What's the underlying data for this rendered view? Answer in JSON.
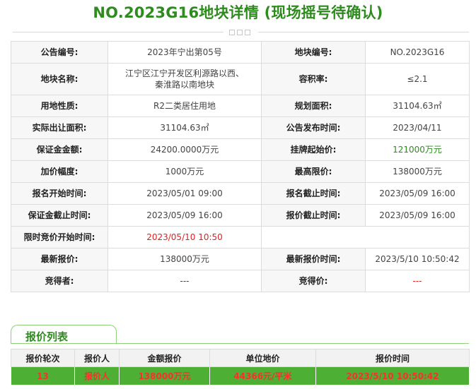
{
  "page": {
    "title": "NO.2023G16地块详情 (现场摇号待确认)"
  },
  "details": {
    "rows": [
      [
        {
          "label": "公告编号:",
          "value": "2023年宁出第05号"
        },
        {
          "label": "地块编号:",
          "value": "NO.2023G16"
        }
      ],
      [
        {
          "label": "地块名称:",
          "value_line1": "江宁区江宁开发区利源路以西、",
          "value_line2": "秦淮路以南地块"
        },
        {
          "label": "容积率:",
          "value": "≤2.1"
        }
      ],
      [
        {
          "label": "用地性质:",
          "value": "R2二类居住用地"
        },
        {
          "label": "规划面积:",
          "value": "31104.63㎡"
        }
      ],
      [
        {
          "label": "实际出让面积:",
          "value": "31104.63㎡"
        },
        {
          "label": "公告发布时间:",
          "value": "2023/04/11"
        }
      ],
      [
        {
          "label": "保证金金额:",
          "value": "24200.0000万元"
        },
        {
          "label": "挂牌起始价:",
          "value": "121000万元"
        }
      ],
      [
        {
          "label": "加价幅度:",
          "value": "1000万元"
        },
        {
          "label": "最高限价:",
          "value": "138000万元"
        }
      ],
      [
        {
          "label": "报名开始时间:",
          "value": "2023/05/01 09:00"
        },
        {
          "label": "报名截止时间:",
          "value": "2023/05/09 16:00"
        }
      ],
      [
        {
          "label": "保证金截止时间:",
          "value": "2023/05/09 16:00"
        },
        {
          "label": "报价截止时间:",
          "value": "2023/05/09 16:00"
        }
      ],
      [
        {
          "label": "限时竞价开始时间:",
          "value": "2023/05/10 10:50"
        }
      ],
      [
        {
          "label": "最新报价:",
          "value": "138000万元"
        },
        {
          "label": "最新报价时间:",
          "value": "2023/5/10 10:50:42"
        }
      ],
      [
        {
          "label": "竞得者:",
          "value": "---"
        },
        {
          "label": "竞得价:",
          "value": "---"
        }
      ]
    ]
  },
  "bid_list": {
    "tab_label": "报价列表",
    "headers": [
      "报价轮次",
      "报价人",
      "金额报价",
      "单位地价",
      "报价时间"
    ],
    "rows": [
      {
        "round": "13",
        "bidder": "报价人",
        "amount": "138000万元",
        "unit_price": "44366元/平米",
        "time": "2023/5/10 10:50:42"
      }
    ]
  },
  "colors": {
    "accent_green": "#2e8b1e",
    "highlight_red": "#e02020",
    "bid_row_bg": "#4db034"
  }
}
